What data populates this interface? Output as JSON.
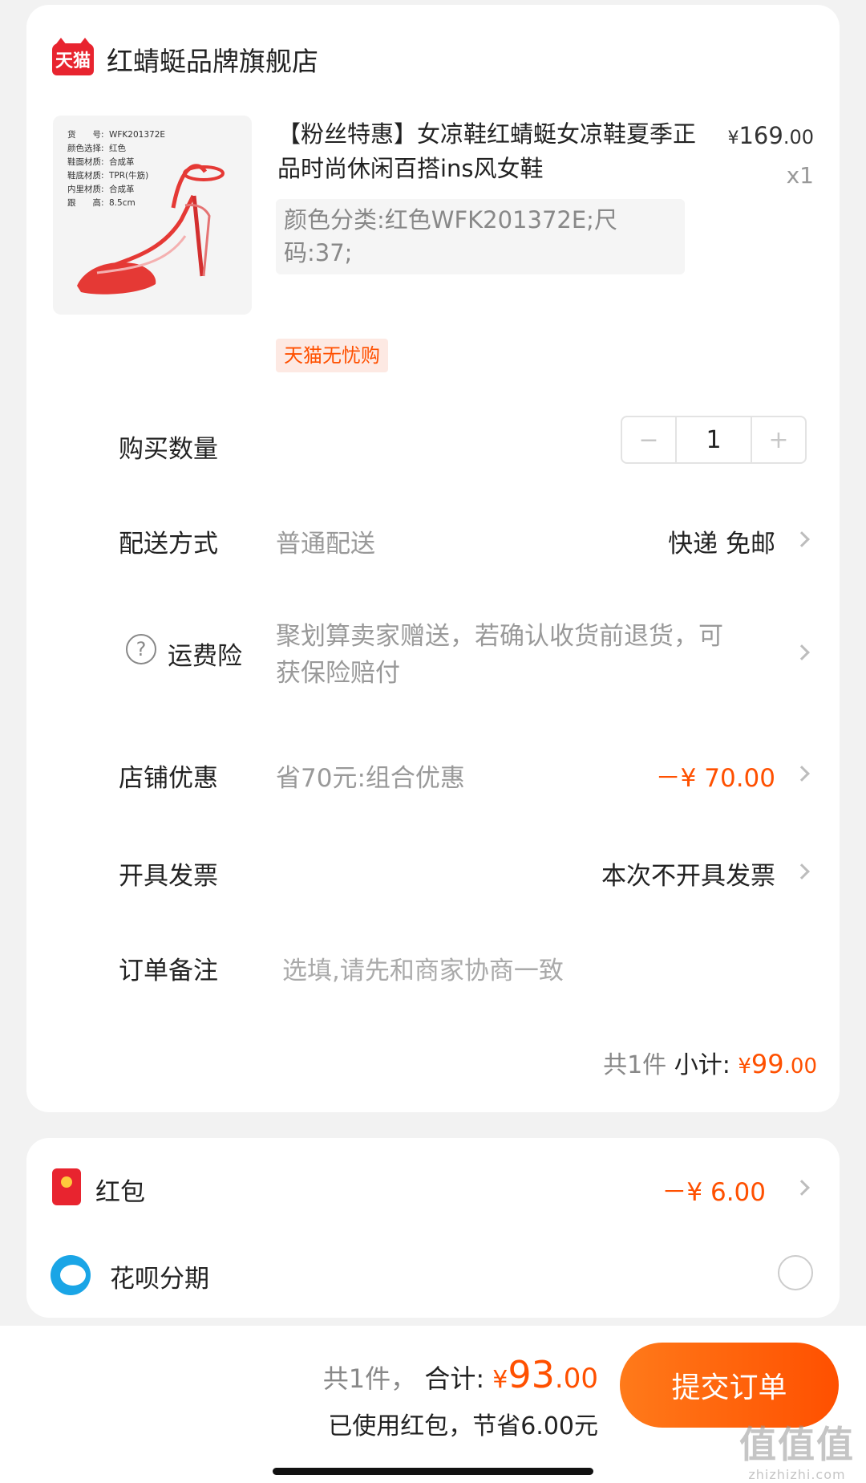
{
  "shop": {
    "logo_text": "天猫",
    "name": "红蜻蜓品牌旗舰店"
  },
  "product": {
    "title": "【粉丝特惠】女凉鞋红蜻蜓女凉鞋夏季正品时尚休闲百搭ins风女鞋",
    "price_currency": "¥",
    "price_int": "169",
    "price_dec": ".00",
    "quantity_text": "x1",
    "sku": "颜色分类:红色WFK201372E;尺码:37;",
    "badge": "天猫无忧购",
    "image_specs": [
      {
        "k": "货　　号:",
        "v": "WFK201372E"
      },
      {
        "k": "颜色选择:",
        "v": "红色"
      },
      {
        "k": "鞋面材质:",
        "v": "合成革"
      },
      {
        "k": "鞋底材质:",
        "v": "TPR(牛筋)"
      },
      {
        "k": "内里材质:",
        "v": "合成革"
      },
      {
        "k": "跟　　高:",
        "v": "8.5cm"
      }
    ]
  },
  "rows": {
    "quantity": {
      "label": "购买数量",
      "minus": "−",
      "value": "1",
      "plus": "+"
    },
    "delivery": {
      "label": "配送方式",
      "sub": "普通配送",
      "value": "快递 免邮"
    },
    "insurance": {
      "icon": "?",
      "label": "运费险",
      "sub": "聚划算卖家赠送，若确认收货前退货，可获保险赔付"
    },
    "discount": {
      "label": "店铺优惠",
      "sub": "省70元:组合优惠",
      "value": "－¥ 70.00"
    },
    "invoice": {
      "label": "开具发票",
      "value": "本次不开具发票"
    },
    "note": {
      "label": "订单备注",
      "placeholder": "选填,请先和商家协商一致"
    }
  },
  "subtotal": {
    "count": "共1件",
    "label": "小计:",
    "currency": "¥",
    "int": "99",
    "dec": ".00"
  },
  "payment": {
    "redpacket": {
      "label": "红包",
      "value": "－¥ 6.00"
    },
    "huabei": {
      "label": "花呗分期"
    }
  },
  "footer": {
    "count": "共1件，",
    "label": "合计:",
    "currency": "¥",
    "int": "93",
    "dec": ".00",
    "saving": "已使用红包，节省6.00元",
    "submit": "提交订单"
  },
  "watermark": {
    "main": "值值值",
    "sub": "zhizhizhi.com"
  },
  "colors": {
    "accent": "#ff5000",
    "tmall_red": "#e8242f"
  }
}
